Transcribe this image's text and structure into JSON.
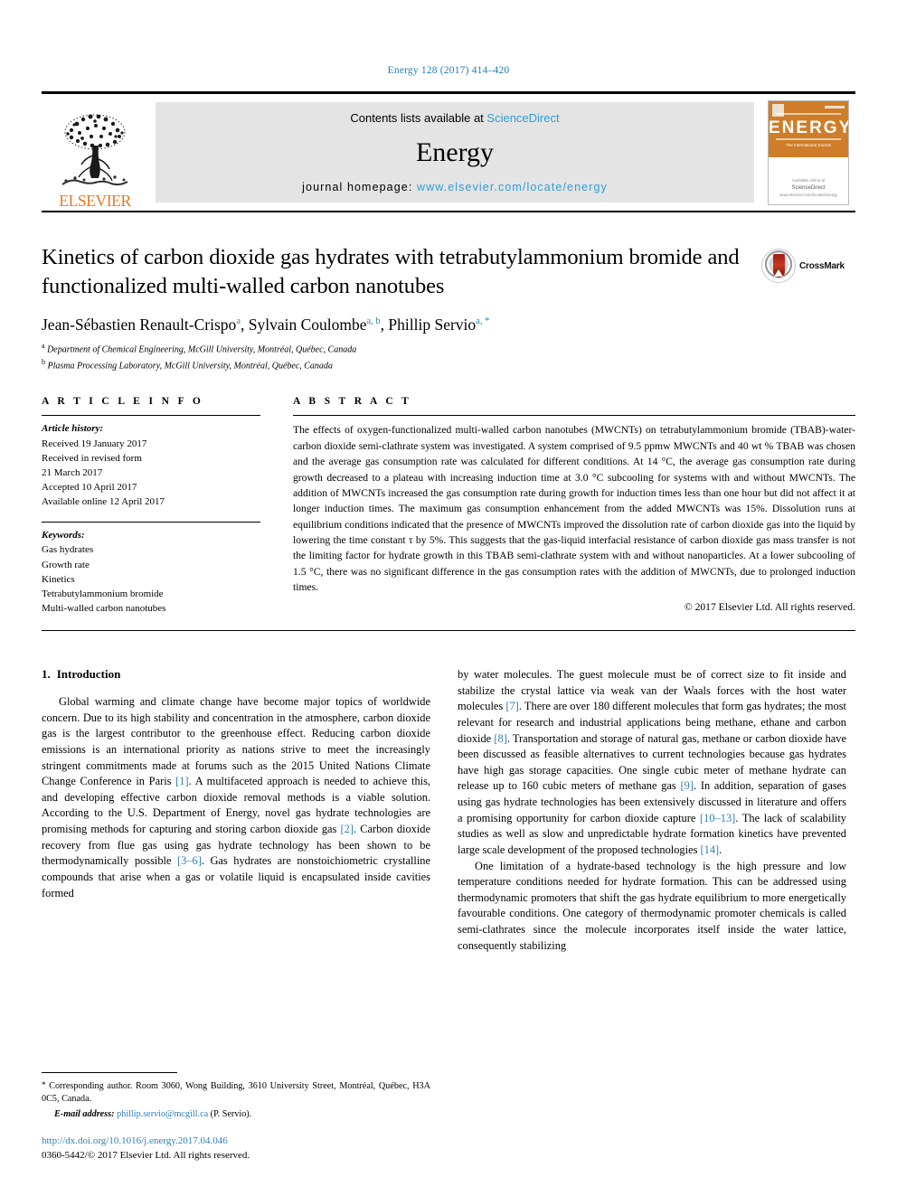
{
  "running_head": "Energy 128 (2017) 414–420",
  "masthead": {
    "publisher_name": "ELSEVIER",
    "contents_prefix": "Contents lists available at ",
    "contents_link": "ScienceDirect",
    "journal_name": "Energy",
    "homepage_prefix": "journal homepage: ",
    "homepage_url": "www.elsevier.com/locate/energy",
    "cover": {
      "title": "ENERGY",
      "subtitle": "The International Journal",
      "footer_line1": "Available online at",
      "footer_line2": "ScienceDirect",
      "footer_line3": "www.elsevier.com/locate/energy"
    }
  },
  "article": {
    "title": "Kinetics of carbon dioxide gas hydrates with tetrabutylammonium bromide and functionalized multi-walled carbon nanotubes",
    "crossmark_label": "CrossMark",
    "authors": [
      {
        "name": "Jean-Sébastien Renault-Crispo",
        "sup": "a",
        "sep": ", "
      },
      {
        "name": "Sylvain Coulombe",
        "sup": "a, b",
        "sep": ", "
      },
      {
        "name": "Phillip Servio",
        "sup": "a, *",
        "sep": ""
      }
    ],
    "affiliations": [
      {
        "mark": "a",
        "text": "Department of Chemical Engineering, McGill University, Montréal, Québec, Canada"
      },
      {
        "mark": "b",
        "text": "Plasma Processing Laboratory, McGill University, Montréal, Québec, Canada"
      }
    ]
  },
  "article_info": {
    "heading": "A R T I C L E   I N F O",
    "history_label": "Article history:",
    "history": [
      "Received 19 January 2017",
      "Received in revised form",
      "21 March 2017",
      "Accepted 10 April 2017",
      "Available online 12 April 2017"
    ],
    "keywords_label": "Keywords:",
    "keywords": [
      "Gas hydrates",
      "Growth rate",
      "Kinetics",
      "Tetrabutylammonium bromide",
      "Multi-walled carbon nanotubes"
    ]
  },
  "abstract": {
    "heading": "A B S T R A C T",
    "text": "The effects of oxygen-functionalized multi-walled carbon nanotubes (MWCNTs) on tetrabutylammonium bromide (TBAB)-water-carbon dioxide semi-clathrate system was investigated. A system comprised of 9.5 ppmw MWCNTs and 40 wt % TBAB was chosen and the average gas consumption rate was calculated for different conditions. At 14 °C, the average gas consumption rate during growth decreased to a plateau with increasing induction time at 3.0 °C subcooling for systems with and without MWCNTs. The addition of MWCNTs increased the gas consumption rate during growth for induction times less than one hour but did not affect it at longer induction times. The maximum gas consumption enhancement from the added MWCNTs was 15%. Dissolution runs at equilibrium conditions indicated that the presence of MWCNTs improved the dissolution rate of carbon dioxide gas into the liquid by lowering the time constant τ by 5%. This suggests that the gas-liquid interfacial resistance of carbon dioxide gas mass transfer is not the limiting factor for hydrate growth in this TBAB semi-clathrate system with and without nanoparticles. At a lower subcooling of 1.5 °C, there was no significant difference in the gas consumption rates with the addition of MWCNTs, due to prolonged induction times.",
    "copyright": "© 2017 Elsevier Ltd. All rights reserved."
  },
  "introduction": {
    "number": "1.",
    "heading": "Introduction",
    "left_para_1": "Global warming and climate change have become major topics of worldwide concern. Due to its high stability and concentration in the atmosphere, carbon dioxide gas is the largest contributor to the greenhouse effect. Reducing carbon dioxide emissions is an international priority as nations strive to meet the increasingly stringent commitments made at forums such as the 2015 United Nations Climate Change Conference in Paris ",
    "ref_1": "[1]",
    "left_para_1b": ". A multifaceted approach is needed to achieve this, and developing effective carbon dioxide removal methods is a viable solution. According to the U.S. Department of Energy, novel gas hydrate technologies are promising methods for capturing and storing carbon dioxide gas ",
    "ref_2": "[2]",
    "left_para_1c": ". Carbon dioxide recovery from flue gas using gas hydrate technology has been shown to be thermodynamically possible ",
    "ref_3_6": "[3–6]",
    "left_para_1d": ". Gas hydrates are nonstoichiometric crystalline compounds that arise when a gas or volatile liquid is encapsulated inside cavities formed",
    "right_para_1a": "by water molecules. The guest molecule must be of correct size to fit inside and stabilize the crystal lattice via weak van der Waals forces with the host water molecules ",
    "ref_7": "[7]",
    "right_para_1b": ". There are over 180 different molecules that form gas hydrates; the most relevant for research and industrial applications being methane, ethane and carbon dioxide ",
    "ref_8": "[8]",
    "right_para_1c": ". Transportation and storage of natural gas, methane or carbon dioxide have been discussed as feasible alternatives to current technologies because gas hydrates have high gas storage capacities. One single cubic meter of methane hydrate can release up to 160 cubic meters of methane gas ",
    "ref_9": "[9]",
    "right_para_1d": ". In addition, separation of gases using gas hydrate technologies has been extensively discussed in literature and offers a promising opportunity for carbon dioxide capture ",
    "ref_10_13": "[10–13]",
    "right_para_1e": ". The lack of scalability studies as well as slow and unpredictable hydrate formation kinetics have prevented large scale development of the proposed technologies ",
    "ref_14": "[14]",
    "right_para_1f": ".",
    "right_para_2": "One limitation of a hydrate-based technology is the high pressure and low temperature conditions needed for hydrate formation. This can be addressed using thermodynamic promoters that shift the gas hydrate equilibrium to more energetically favourable conditions. One category of thermodynamic promoter chemicals is called semi-clathrates since the molecule incorporates itself inside the water lattice, consequently stabilizing"
  },
  "footnote": {
    "corresponding": "Corresponding author. Room 3060, Wong Building, 3610 University Street, Montréal, Québec, H3A 0C5, Canada.",
    "email_label": "E-mail address:",
    "email": "phillip.servio@mcgill.ca",
    "email_suffix": " (P. Servio).",
    "doi": "http://dx.doi.org/10.1016/j.energy.2017.04.046",
    "issn_line": "0360-5442/© 2017 Elsevier Ltd. All rights reserved."
  },
  "colors": {
    "link_blue": "#2e7fb5",
    "sciencedirect_blue": "#2e9fd4",
    "elsevier_orange": "#e87722",
    "cover_orange": "#cf7d28"
  }
}
